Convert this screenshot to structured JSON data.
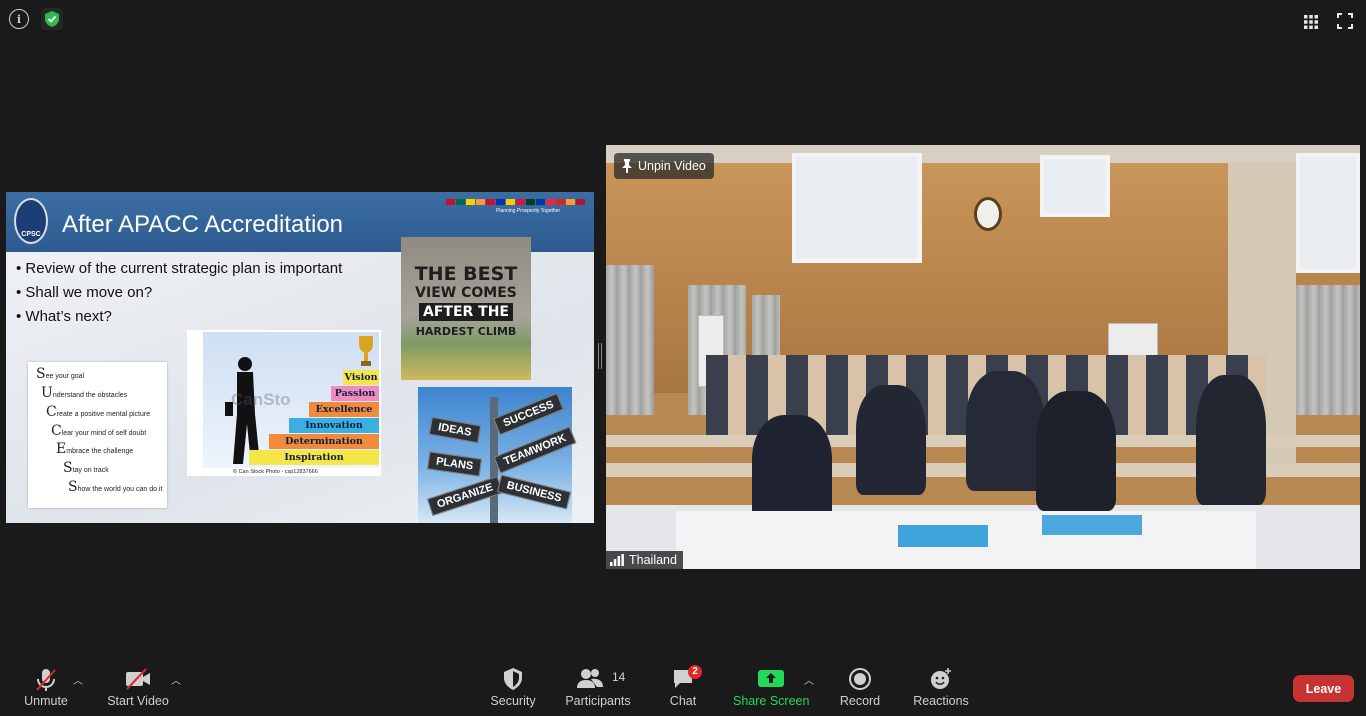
{
  "top_bar": {
    "info_icon": "info-icon",
    "security_icon": "shield-check-icon",
    "gallery_icon": "grid-icon",
    "fullscreen_icon": "fullscreen-icon"
  },
  "slide": {
    "title": "After APACC Accreditation",
    "logo_text": "CPSC",
    "tagline": "Planning Prosperity Together",
    "bullets": [
      "Review of the current strategic plan  is important",
      "Shall we move on?",
      "What’s next?"
    ],
    "success_acrostic": [
      {
        "initial": "S",
        "rest": "ee your goal"
      },
      {
        "initial": "U",
        "rest": "nderstand the obstacles"
      },
      {
        "initial": "C",
        "rest": "reate a positive mental picture"
      },
      {
        "initial": "C",
        "rest": "lear your mind of self doubt"
      },
      {
        "initial": "E",
        "rest": "mbrace the challenge"
      },
      {
        "initial": "S",
        "rest": "tay on track"
      },
      {
        "initial": "S",
        "rest": "how the world you can do it"
      }
    ],
    "stairs_steps": [
      "Inspiration",
      "Determination",
      "Innovation",
      "Excellence",
      "Passion",
      "Vision"
    ],
    "stairs_watermark": "CanSto",
    "stairs_credit": "© Can Stock Photo - csp12837666",
    "quote_lines": [
      "THE BEST",
      "VIEW COMES",
      "AFTER THE",
      "HARDEST CLIMB"
    ],
    "signs": [
      "IDEAS",
      "SUCCESS",
      "PLANS",
      "TEAMWORK",
      "ORGANIZE",
      "BUSINESS"
    ],
    "colors": {
      "header": "#2d5b8f"
    }
  },
  "video": {
    "unpin_label": "Unpin Video",
    "participant_name": "Thailand"
  },
  "toolbar": {
    "unmute_label": "Unmute",
    "start_video_label": "Start Video",
    "security_label": "Security",
    "participants_label": "Participants",
    "participants_count": "14",
    "chat_label": "Chat",
    "chat_badge": "2",
    "share_label": "Share Screen",
    "record_label": "Record",
    "reactions_label": "Reactions",
    "leave_label": "Leave",
    "colors": {
      "share": "#23d959",
      "leave": "#c73232"
    }
  }
}
